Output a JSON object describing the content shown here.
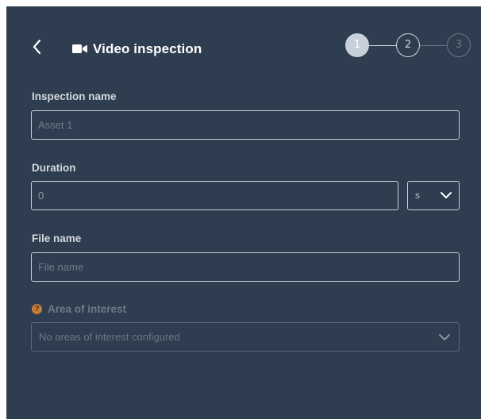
{
  "header": {
    "title": "Video inspection",
    "back_icon": "chevron-left-icon",
    "title_icon": "video-camera-icon"
  },
  "stepper": {
    "steps": [
      "1",
      "2",
      "3"
    ],
    "current_step": 1
  },
  "form": {
    "inspection_name": {
      "label": "Inspection name",
      "placeholder": "Asset 1",
      "value": ""
    },
    "duration": {
      "label": "Duration",
      "value": "0",
      "unit": "s"
    },
    "file_name": {
      "label": "File name",
      "placeholder": "File name",
      "value": ""
    },
    "area_of_interest": {
      "label": "Area of interest",
      "help_glyph": "?",
      "placeholder": "No areas of interest configured"
    }
  },
  "colors": {
    "panel_bg": "#2e3d4f",
    "input_border": "#c9d0d7",
    "help_icon": "#c97b31",
    "active_step": "#c8d0d9"
  }
}
